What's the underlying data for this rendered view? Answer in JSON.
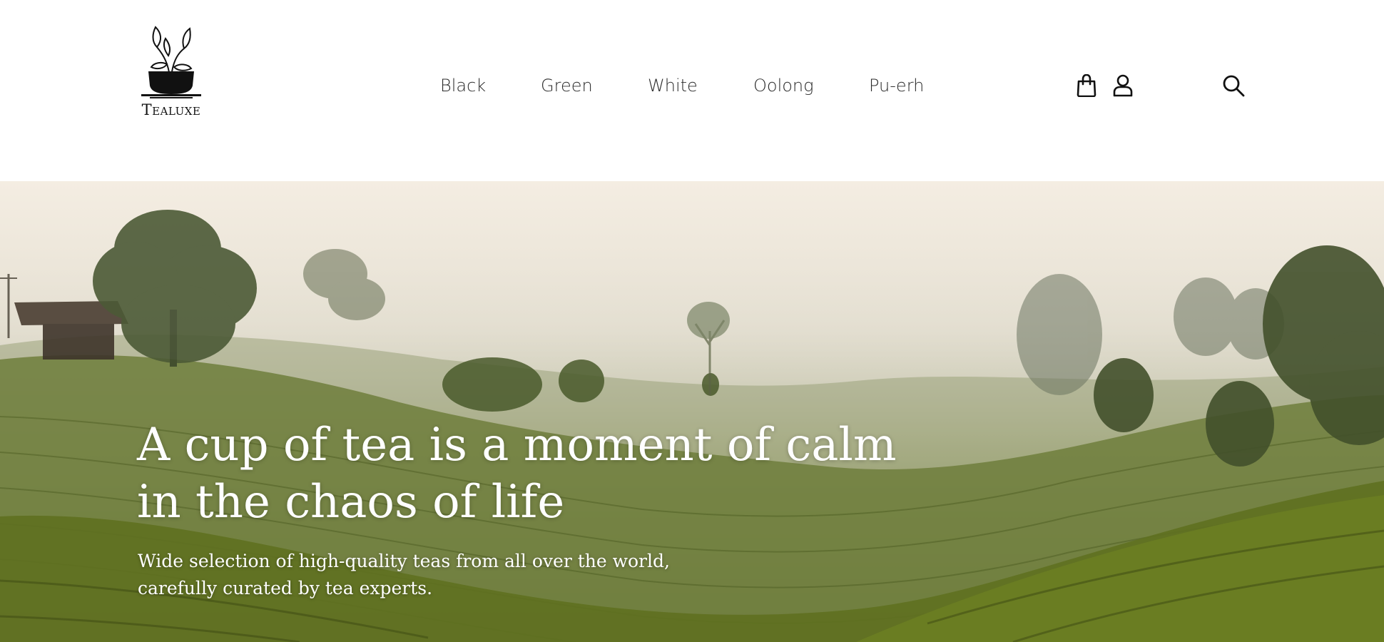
{
  "brand": {
    "name": "Tealuxe",
    "logo_icon": "tea-cup-leaves-icon"
  },
  "nav": {
    "items": [
      {
        "label": "Black"
      },
      {
        "label": "Green"
      },
      {
        "label": "White"
      },
      {
        "label": "Oolong"
      },
      {
        "label": "Pu-erh"
      }
    ]
  },
  "header_icons": {
    "cart": "shopping-bag-icon",
    "account": "user-icon",
    "search": "search-icon"
  },
  "hero": {
    "title_line1": "A cup of tea is a moment of calm",
    "title_line2": "in the chaos of life",
    "subtitle_line1": "Wide selection of high-quality teas from all over the world,",
    "subtitle_line2": "carefully curated by tea experts.",
    "image": "misty tea plantation hills"
  },
  "colors": {
    "text_dark": "#2b2b2b",
    "hero_text": "#ffffff",
    "accent_green": "#5b6c24"
  }
}
